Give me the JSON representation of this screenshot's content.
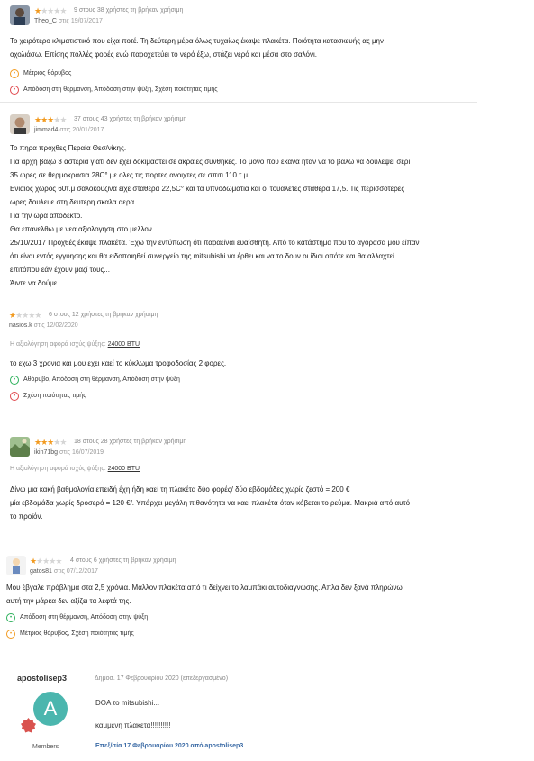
{
  "reviews": [
    {
      "rating": 1,
      "helpful": "9 στους 38 χρήστες τη βρήκαν χρήσιμη",
      "author": "Theo_C",
      "on": "στις",
      "date": "19/07/2017",
      "avatar": "person-photo-avatar",
      "text": [
        "Το χειρότερο κλιματιστικό που είχα ποτέ. Τη δεύτερη μέρα όλως τυχαίως έκαψε πλακέτα. Ποιότητα κατασκευής ας μην",
        "οχολιάσω. Επίσης πολλές φορές ενώ παροχετεύει το νερό έξω, στάζει νερό και μέσα στο σαλόνι."
      ],
      "aspects": [
        {
          "icon": "meh-face-icon",
          "text": "Μέτριος θόρυβος"
        },
        {
          "icon": "frown-face-icon",
          "text": "Απόδοση στη θέρμανση, Απόδοση στην ψύξη, Σχέση ποιότητας τιμής"
        }
      ]
    },
    {
      "rating": 3,
      "helpful": "37 στους 43 χρήστες τη βρήκαν χρήσιμη",
      "author": "jimmad4",
      "on": "στις",
      "date": "20/01/2017",
      "avatar": "person-photo-avatar",
      "text": [
        "Το πηρα προχθες Περαία Θεσ/νίκης.",
        "Για αρχη βαζω 3 αστερια γιατι δεν εχει δοκιμαστει σε ακραιες συνθηκες. Το μονο που εκανα ηταν να το βαλω να δουλεψει σερι",
        "35 ωρες σε θερμοκρασια 28C° με ολες τις πορτες ανοιχτες σε σπιτι 110 τ.μ .",
        "Ενιαιος χωρος 60τ.μ σαλοκουζινα ειχε σταθερα 22,5C° και τα υπνοδωματια και οι τουαλετες σταθερα 17,5. Τις περισσοτερες",
        "ωρες δουλευε στη δευτερη σκαλα αερα.",
        "Για την ωρα αποδεκτο.",
        "Θα επανελθω με νεα αξιολογηση στο μελλον.",
        "25/10/2017 Προχθές έκαψε πλακέτα. Έχω την εντύπωση ότι παραείναι ευαίσθητη. Από το κατάστημα που το αγόρασα μου είπαν",
        "ότι είναι εντός εγγύησης και θα ειδοποιηθεί συνεργείο της mitsubishi να έρθει και να το δουν οι ίδιοι οπότε και θα αλλαχτεί",
        "επιτόπου εάν έχουν μαζί τους...",
        "Άιντε να δούμε"
      ],
      "aspects": []
    },
    {
      "rating": 1,
      "helpful": "6 στους 12 χρήστες τη βρήκαν χρήσιμη",
      "author": "nasios.k",
      "on": "στις",
      "date": "12/02/2020",
      "btu_label": "Η αξιολόγηση αφορά ισχύς ψύξης:",
      "btu_value": "24000 BTU",
      "text": [
        "το εχω 3 χρονια και μου εχει καεί το κύκλωμα τροφοδοσίας 2 φορες."
      ],
      "aspects": [
        {
          "icon": "smile-face-icon",
          "text": "Αθόρυβο, Απόδοση στη θέρμανση, Απόδοση στην ψύξη"
        },
        {
          "icon": "frown-face-icon",
          "text": "Σχέση ποιότητας τιμής"
        }
      ]
    },
    {
      "rating": 3,
      "helpful": "18 στους 28 χρήστες τη βρήκαν χρήσιμη",
      "author": "ikin71bg",
      "on": "στις",
      "date": "16/07/2019",
      "avatar": "landscape-photo-avatar",
      "btu_label": "Η αξιολόγηση αφορά ισχύς ψύξης:",
      "btu_value": "24000 BTU",
      "text": [
        "Δίνω μια κακή βαθμολογία επειδή έχη ήδη καεί τη πλακέτα δύο φορές/ δύο εβδομάδες χωρίς ζεστό = 200 €",
        "μία εβδομάδα χωρίς δροσερό = 120 €/. Υπάρχει μεγάλη πιθανότητα να καεί πλακέτα όταν κόβεται το ρεύμα. Μακριά από αυτό",
        "το προϊόν."
      ],
      "aspects": []
    },
    {
      "rating": 1,
      "helpful": "4 στους 6 χρήστες τη βρήκαν χρήσιμη",
      "author": "gatos81",
      "on": "στις",
      "date": "07/12/2017",
      "avatar": "cartoon-avatar",
      "text": [
        "Μου έβγαλε πρόβλημα στα 2,5 χρόνια. Μάλλον πλακέτα από τι δείχνει το λαμπάκι αυτοδιαγνωσης. Απλα δεν ξανά πληρώνω",
        "αυτή την μάρκα δεν αξίζει τα λεφτά της."
      ],
      "aspects": [
        {
          "icon": "smile-face-icon",
          "text": "Απόδοση στη θέρμανση, Απόδοση στην ψύξη"
        },
        {
          "icon": "meh-face-icon",
          "text": "Μέτριος θόρυβος, Σχέση ποιότητας τιμής"
        }
      ]
    }
  ],
  "forum_post": {
    "username": "apostolisep3",
    "avatar_letter": "A",
    "avatar_color": "#4bb6ae",
    "badge_color": "#d9534f",
    "role": "Members",
    "date": "Δημοσ. 17 Φεβρουαρίου 2020 (επεξεργασμένο)",
    "line1": "DOA το mitsubishi...",
    "line2": "καμμενη πλακετα!!!!!!!!!!",
    "edited": "Επεξ/σία 17 Φεβρουαρίου 2020 από apostolisep3"
  },
  "colors": {
    "star_on": "#f29a1f",
    "star_off": "#d5d5d5",
    "positive": "#2bb05a",
    "neutral": "#f29a1f",
    "negative": "#e0474c",
    "link": "#3a6aa5"
  }
}
